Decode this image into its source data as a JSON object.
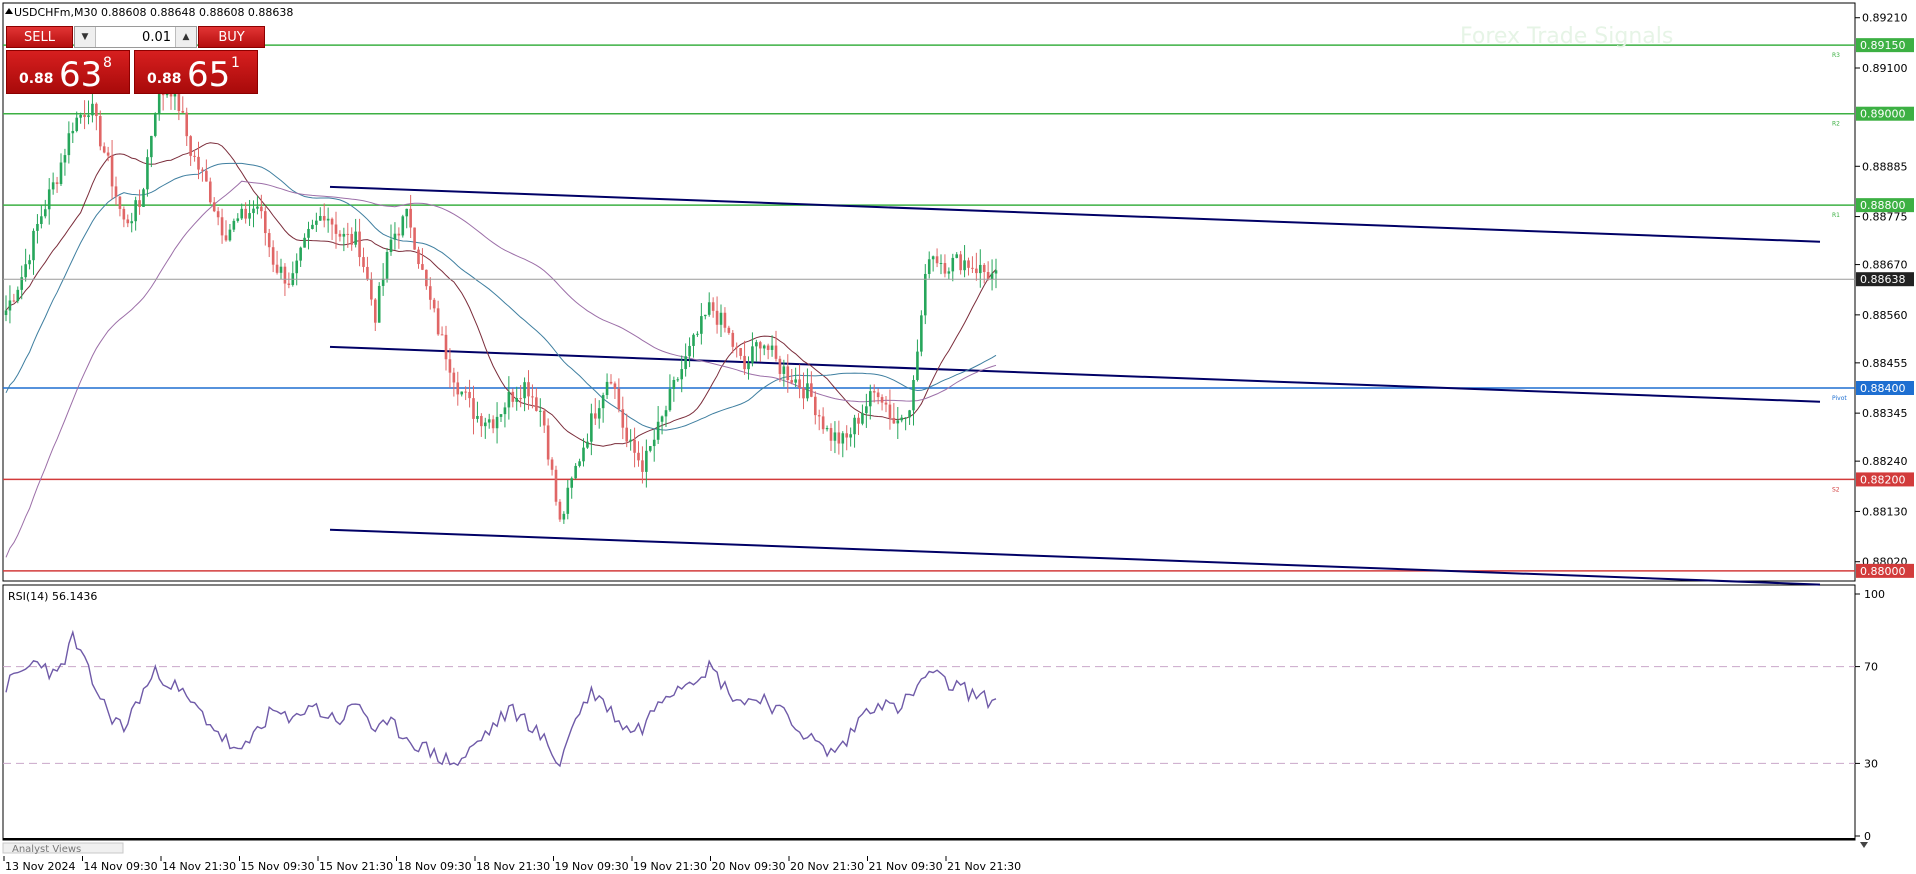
{
  "symbol_header": "USDCHFm,M30  0.88608 0.88648 0.88608 0.88638",
  "trade_panel": {
    "sell_label": "SELL",
    "buy_label": "BUY",
    "lot": "0.01",
    "sell_small": "0.88",
    "sell_big": "63",
    "sell_sup": "8",
    "buy_small": "0.88",
    "buy_big": "65",
    "buy_sup": "1"
  },
  "price_axis": {
    "ticks": [
      "0.89210",
      "0.89100",
      "0.88885",
      "0.88775",
      "0.88670",
      "0.88560",
      "0.88455",
      "0.88345",
      "0.88240",
      "0.88130",
      "0.88020"
    ],
    "tick_values": [
      0.8921,
      0.891,
      0.88885,
      0.88775,
      0.8867,
      0.8856,
      0.88455,
      0.88345,
      0.8824,
      0.8813,
      0.8802
    ],
    "current_price": "0.88638"
  },
  "levels": [
    {
      "value": 0.8915,
      "label": "0.89150",
      "tag": "R3",
      "color": "#3cb043"
    },
    {
      "value": 0.89,
      "label": "0.89000",
      "tag": "R2",
      "color": "#3cb043"
    },
    {
      "value": 0.888,
      "label": "0.88800",
      "tag": "R1",
      "color": "#3cb043"
    },
    {
      "value": 0.884,
      "label": "0.88400",
      "tag": "Pivot",
      "color": "#1e6fd1"
    },
    {
      "value": 0.882,
      "label": "0.88200",
      "tag": "S2",
      "color": "#d23b3b"
    },
    {
      "value": 0.88,
      "label": "0.88000",
      "tag": "",
      "color": "#d23b3b"
    }
  ],
  "watermark": "Forex Trade Signals",
  "rsi": {
    "label": "RSI(14) 56.1436",
    "ticks": [
      "100",
      "70",
      "30",
      "0"
    ]
  },
  "time_axis": [
    "13 Nov 2024",
    "14 Nov 09:30",
    "14 Nov 21:30",
    "15 Nov 09:30",
    "15 Nov 21:30",
    "18 Nov 09:30",
    "18 Nov 21:30",
    "19 Nov 09:30",
    "19 Nov 21:30",
    "20 Nov 09:30",
    "20 Nov 21:30",
    "21 Nov 09:30",
    "21 Nov 21:30"
  ],
  "analyst_views": "Analyst Views",
  "colors": {
    "bull": "#26a65b",
    "bear": "#e06666",
    "ma_fast": "#7b2d3b",
    "ma_mid": "#3f7fa0",
    "ma_slow": "#9c6fa8",
    "rsi_line": "#6f5aa8",
    "channel": "#000066"
  },
  "chart_data": {
    "type": "candlestick",
    "title": "USDCHFm,M30",
    "y_range": [
      0.8798,
      0.8924
    ],
    "ohlc_anchors": [
      0.8857,
      0.8865,
      0.8877,
      0.8886,
      0.8898,
      0.8902,
      0.889,
      0.8876,
      0.888,
      0.8904,
      0.8906,
      0.8892,
      0.8884,
      0.8874,
      0.8877,
      0.888,
      0.8867,
      0.8863,
      0.8873,
      0.8879,
      0.8873,
      0.8872,
      0.8856,
      0.8873,
      0.8878,
      0.8862,
      0.885,
      0.884,
      0.8834,
      0.8833,
      0.8838,
      0.8841,
      0.8834,
      0.881,
      0.8823,
      0.8834,
      0.8844,
      0.8828,
      0.8823,
      0.8832,
      0.8842,
      0.885,
      0.8858,
      0.8852,
      0.8844,
      0.8851,
      0.8845,
      0.8842,
      0.8838,
      0.883,
      0.8828,
      0.8835,
      0.884,
      0.8832,
      0.8838,
      0.887,
      0.8867,
      0.8868,
      0.8866,
      0.8864
    ],
    "candle_count": 253,
    "channel_lines": [
      {
        "from": [
          "15 Nov 21:30",
          0.8884
        ],
        "to": [
          "end",
          0.8872
        ]
      },
      {
        "from": [
          "15 Nov 21:30",
          0.8849
        ],
        "to": [
          "end",
          0.8837
        ]
      },
      {
        "from": [
          "15 Nov 21:30",
          0.8809
        ],
        "to": [
          "end",
          0.8797
        ]
      }
    ],
    "rsi_range": [
      0,
      100
    ],
    "rsi_levels": [
      70,
      30
    ],
    "rsi_anchors": [
      62,
      68,
      73,
      65,
      82,
      66,
      52,
      44,
      58,
      68,
      62,
      55,
      48,
      40,
      33,
      45,
      52,
      46,
      55,
      50,
      48,
      56,
      43,
      46,
      40,
      36,
      32,
      30,
      38,
      45,
      52,
      48,
      40,
      30,
      50,
      60,
      52,
      44,
      45,
      58,
      62,
      66,
      70,
      60,
      55,
      58,
      52,
      46,
      40,
      34,
      38,
      50,
      56,
      52,
      58,
      68,
      63,
      61,
      57,
      56
    ]
  }
}
